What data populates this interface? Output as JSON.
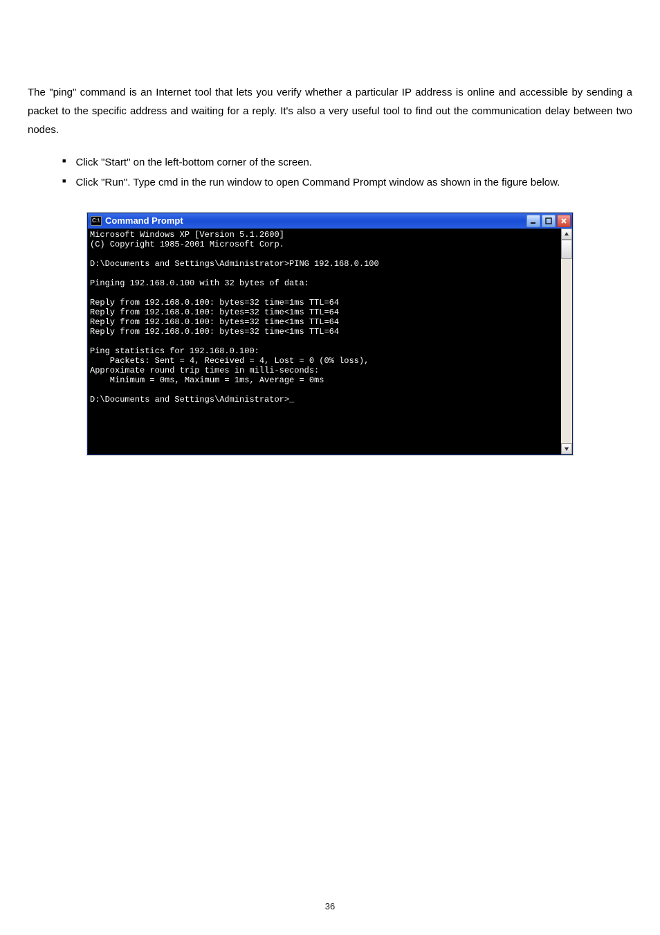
{
  "para1": "The \"ping\" command is an Internet tool that lets you verify whether a particular IP address is online and accessible by sending a packet to the specific address and waiting for a reply. It's also a very useful tool to find out the communication delay between two nodes.",
  "bullets": [
    "Click \"Start\" on the left-bottom corner of the screen.",
    "Click \"Run\". Type cmd in the run window to open Command Prompt window as shown in the figure below."
  ],
  "cmd": {
    "icon_label": "C:\\",
    "title": "Command Prompt",
    "console_text": "Microsoft Windows XP [Version 5.1.2600]\n(C) Copyright 1985-2001 Microsoft Corp.\n\nD:\\Documents and Settings\\Administrator>PING 192.168.0.100\n\nPinging 192.168.0.100 with 32 bytes of data:\n\nReply from 192.168.0.100: bytes=32 time=1ms TTL=64\nReply from 192.168.0.100: bytes=32 time<1ms TTL=64\nReply from 192.168.0.100: bytes=32 time<1ms TTL=64\nReply from 192.168.0.100: bytes=32 time<1ms TTL=64\n\nPing statistics for 192.168.0.100:\n    Packets: Sent = 4, Received = 4, Lost = 0 (0% loss),\nApproximate round trip times in milli-seconds:\n    Minimum = 0ms, Maximum = 1ms, Average = 0ms\n\nD:\\Documents and Settings\\Administrator>_\n\n\n\n\n\n"
  },
  "footer": "36"
}
